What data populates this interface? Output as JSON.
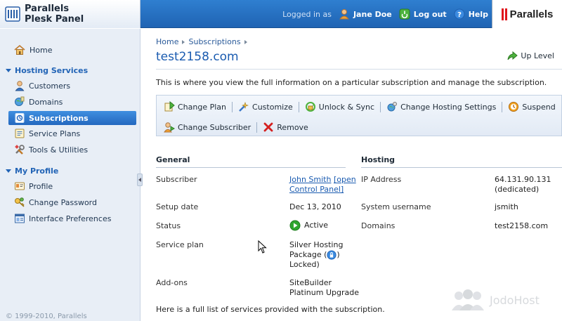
{
  "header": {
    "product_line1": "Parallels",
    "product_line2": "Plesk Panel",
    "logged_in_label": "Logged in as",
    "user_name": "Jane Doe",
    "logout_label": "Log out",
    "help_label": "Help",
    "brand": "Parallels"
  },
  "sidebar": {
    "home": "Home",
    "sections": [
      {
        "title": "Hosting Services",
        "items": [
          "Customers",
          "Domains",
          "Subscriptions",
          "Service Plans",
          "Tools & Utilities"
        ]
      },
      {
        "title": "My Profile",
        "items": [
          "Profile",
          "Change Password",
          "Interface Preferences"
        ]
      }
    ],
    "active_item": "Subscriptions",
    "copyright": "© 1999-2010, Parallels"
  },
  "main": {
    "breadcrumb": [
      "Home",
      "Subscriptions"
    ],
    "title": "test2158.com",
    "up_level": "Up Level",
    "description": "This is where you view the full information on a particular subscription and manage the subscription.",
    "toolbar_row1": [
      "Change Plan",
      "Customize",
      "Unlock & Sync",
      "Change Hosting Settings",
      "Suspend"
    ],
    "toolbar_row2": [
      "Change Subscriber",
      "Remove"
    ],
    "general": {
      "title": "General",
      "subscriber_label": "Subscriber",
      "subscriber_name": "John Smith",
      "subscriber_link_a": "[open",
      "subscriber_link_b": "Control Panel]",
      "setup_label": "Setup date",
      "setup_value": "Dec 13, 2010",
      "status_label": "Status",
      "status_value": "Active",
      "plan_label": "Service plan",
      "plan_line1": "Silver Hosting",
      "plan_line2a": "Package (",
      "plan_line2b": ")",
      "plan_line3": "Locked)",
      "addons_label": "Add-ons",
      "addons_line1": "SiteBuilder",
      "addons_line2": "Platinum Upgrade"
    },
    "hosting": {
      "title": "Hosting",
      "ip_label": "IP Address",
      "ip_value": "64.131.90.131",
      "ip_note": "(dedicated)",
      "username_label": "System username",
      "username_value": "jsmith",
      "domains_label": "Domains",
      "domains_value": "test2158.com"
    },
    "footer_note": "Here is a full list of services provided with the subscription."
  },
  "watermark": "JodoHost",
  "colors": {
    "header_blue": "#2468bf",
    "link_blue": "#1a5bb0",
    "sidebar_bg": "#e8eef6",
    "active_item": "#2f7bd4",
    "brand_red": "#e0141c",
    "status_green": "#2fa62f"
  }
}
